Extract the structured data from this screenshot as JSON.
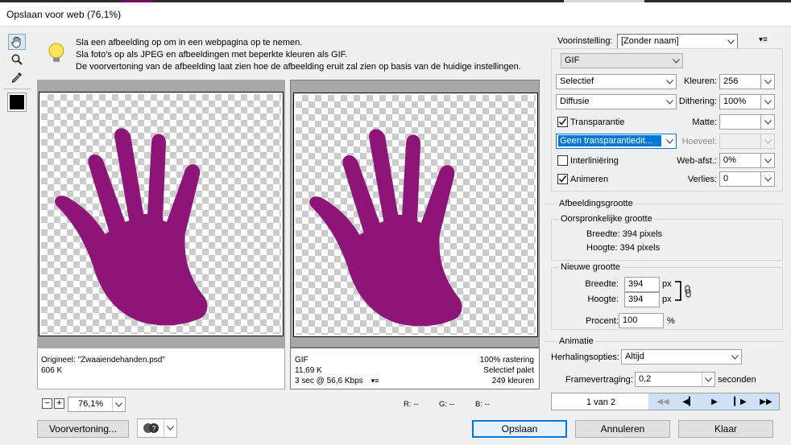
{
  "window": {
    "title": "Opslaan voor web (76,1%)"
  },
  "tools": [
    {
      "name": "hand-tool-icon",
      "glyph": "✋"
    },
    {
      "name": "zoom-tool-icon",
      "glyph": "🔍"
    },
    {
      "name": "eyedropper-tool-icon",
      "glyph": "✒"
    }
  ],
  "info": {
    "line1": "Sla een afbeelding op om in een webpagina op te nemen.",
    "line2": "Sla foto's op als JPEG en afbeeldingen met beperkte kleuren als GIF.",
    "line3": "De voorvertoning van de afbeelding laat zien hoe de afbeelding eruit zal zien op basis van de huidige instellingen."
  },
  "original_pane": {
    "name": "Origineel: \"Zwaaiendehanden.psd\"",
    "size": "606 K"
  },
  "optimized_pane": {
    "format": "GIF",
    "size": "11,69 K",
    "time": "3 sec @ 56,6 Kbps",
    "dither_info": "100% rastering",
    "palette_info": "Selectief palet",
    "colors_info": "249 kleuren"
  },
  "hand_color": "#8e1577",
  "zoom": {
    "value": "76,1%"
  },
  "readouts": {
    "r": "R: --",
    "g": "G: --",
    "b": "B: --"
  },
  "preset": {
    "label": "Voorinstelling:",
    "value": "[Zonder naam]"
  },
  "format_value": "GIF",
  "settings": {
    "reduction": "Selectief",
    "colors_label": "Kleuren:",
    "colors_value": "256",
    "dither_algo": "Diffusie",
    "dithering_label": "Dithering:",
    "dithering_value": "100%",
    "transparency_label": "Transparantie",
    "matte_label": "Matte:",
    "matte_value": "",
    "transparency_dither": "Geen transparantiedit...",
    "amount_label": "Hoeveel:",
    "amount_value": "",
    "interlaced_label": "Interliniëring",
    "websnap_label": "Web-afst.:",
    "websnap_value": "0%",
    "animate_label": "Animeren",
    "lossy_label": "Verlies:",
    "lossy_value": "0"
  },
  "image_size": {
    "title": "Afbeeldingsgrootte",
    "original_title": "Oorspronkelijke grootte",
    "orig_width": "Breedte:  394 pixels",
    "orig_height": "Hoogte:  394 pixels",
    "new_title": "Nieuwe grootte",
    "width_label": "Breedte:",
    "width_value": "394",
    "height_label": "Hoogte:",
    "height_value": "394",
    "unit": "px",
    "percent_label": "Procent:",
    "percent_value": "100",
    "percent_unit": "%"
  },
  "animation": {
    "title": "Animatie",
    "loop_label": "Herhalingsopties:",
    "loop_value": "Altijd",
    "delay_label": "Framevertraging:",
    "delay_value": "0,2",
    "delay_unit": "seconden",
    "frame_counter": "1 van 2"
  },
  "buttons": {
    "preview": "Voorvertoning...",
    "save": "Opslaan",
    "cancel": "Annuleren",
    "done": "Klaar"
  }
}
